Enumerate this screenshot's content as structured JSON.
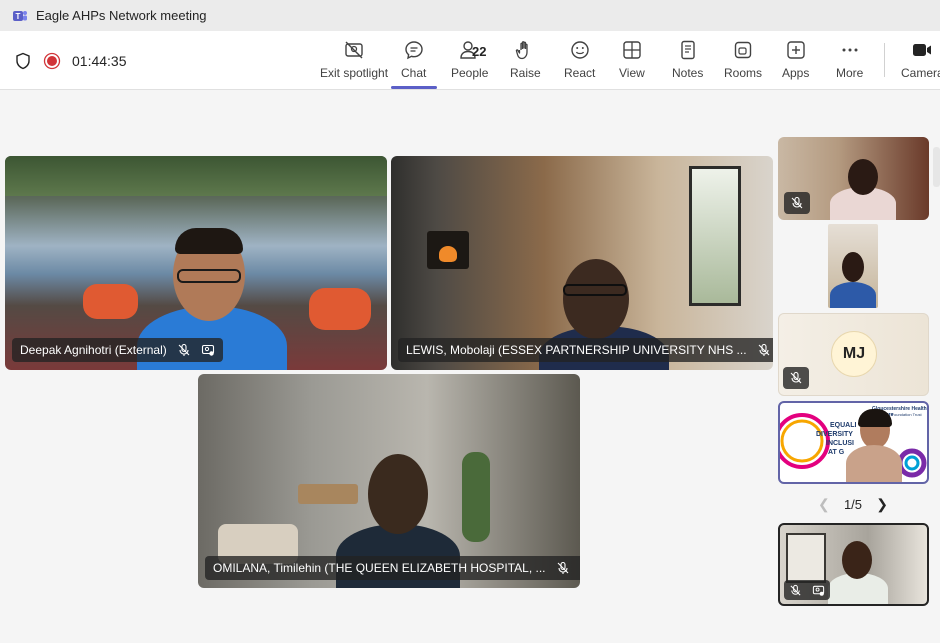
{
  "window": {
    "title": "Eagle AHPs Network meeting"
  },
  "meeting": {
    "timer": "01:44:35"
  },
  "toolbar": {
    "exit_spotlight": "Exit spotlight",
    "chat": "Chat",
    "people": "People",
    "people_count": "22",
    "raise": "Raise",
    "react": "React",
    "view": "View",
    "notes": "Notes",
    "rooms": "Rooms",
    "apps": "Apps",
    "more": "More",
    "camera": "Camera"
  },
  "participants": {
    "main": [
      {
        "name": "Deepak Agnihotri (External)"
      },
      {
        "name": "LEWIS, Mobolaji (ESSEX PARTNERSHIP UNIVERSITY NHS ..."
      },
      {
        "name": "OMILANA, Timilehin (THE QUEEN ELIZABETH HOSPITAL, ..."
      }
    ],
    "sidebar": [
      {
        "initials": "MJ"
      }
    ]
  },
  "slide": {
    "org": "Gloucestershire Health and Care",
    "org_sub": "NHS Foundation Trust",
    "lines": [
      "EQUALI",
      "DIVERSITY",
      "INCLUSI",
      "AT G"
    ]
  },
  "pager": {
    "label": "1/5"
  },
  "colors": {
    "accent": "#5b5fc7",
    "record": "#d13438",
    "chip_bg": "#232323"
  }
}
